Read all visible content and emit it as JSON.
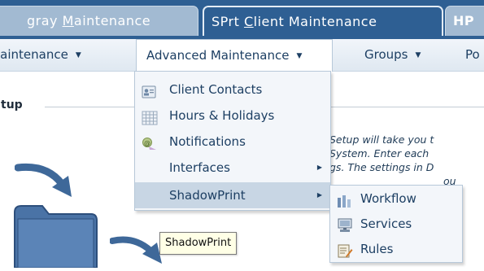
{
  "tabs": [
    {
      "label_pre": "gray ",
      "label_ul": "M",
      "label_post": "aintenance",
      "state": "inactive"
    },
    {
      "label_pre": "SPrt ",
      "label_ul": "C",
      "label_post": "lient Maintenance",
      "state": "active"
    },
    {
      "label": "HP",
      "state": "inactive"
    }
  ],
  "menubar": {
    "items": [
      "laintenance",
      "Advanced Maintenance",
      "Groups",
      "Po"
    ],
    "caret": "▼"
  },
  "page": {
    "section_title": "tup",
    "intro_lines": [
      "Setup will take you t",
      "System.  Enter each",
      "gs. The settings in D",
      "ou"
    ]
  },
  "advanced_menu": {
    "items": [
      {
        "label": "Client Contacts",
        "icon": "contact-card-icon"
      },
      {
        "label": "Hours & Holidays",
        "icon": "calendar-grid-icon"
      },
      {
        "label": "Notifications",
        "icon": "notification-icon"
      },
      {
        "label": "Interfaces",
        "has_submenu": true
      },
      {
        "label": "ShadowPrint",
        "has_submenu": true,
        "highlighted": true
      }
    ],
    "submenu_arrow": "▶"
  },
  "shadowprint_submenu": {
    "items": [
      {
        "label": "Workflow",
        "icon": "workflow-bars-icon"
      },
      {
        "label": "Services",
        "icon": "monitor-icon"
      },
      {
        "label": "Rules",
        "icon": "rules-clipboard-icon"
      }
    ]
  },
  "tooltip": {
    "text": "ShadowPrint"
  },
  "colors": {
    "tab_bar": "#2e5f93",
    "inactive_tab": "#a2bad2",
    "menu_text": "#1d3f63",
    "highlight": "#c8d6e4",
    "arrow_blue": "#3e6899",
    "folder_blue": "#4a73a6"
  }
}
